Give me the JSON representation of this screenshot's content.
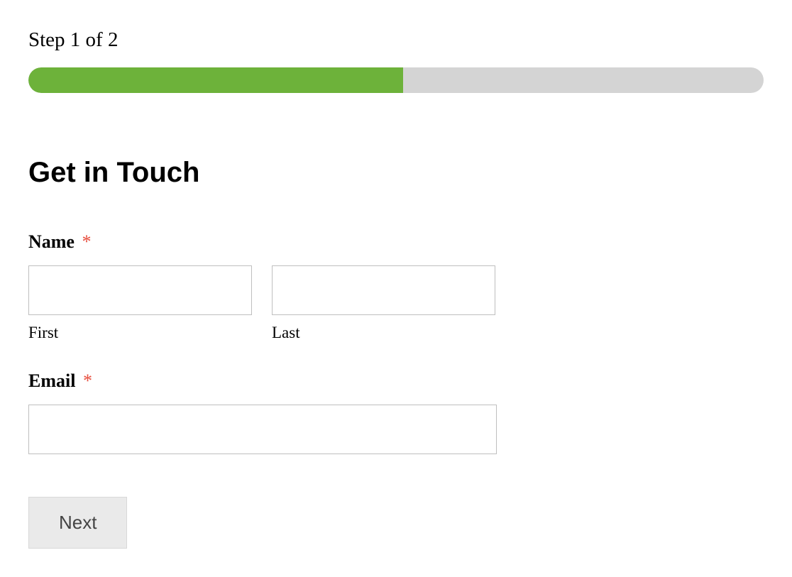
{
  "progress": {
    "step_text": "Step 1 of 2",
    "percent": 51
  },
  "form": {
    "heading": "Get in Touch",
    "name": {
      "label": "Name",
      "required_marker": "*",
      "first": {
        "value": "",
        "sub_label": "First"
      },
      "last": {
        "value": "",
        "sub_label": "Last"
      }
    },
    "email": {
      "label": "Email",
      "required_marker": "*",
      "value": ""
    },
    "next_button_label": "Next"
  }
}
